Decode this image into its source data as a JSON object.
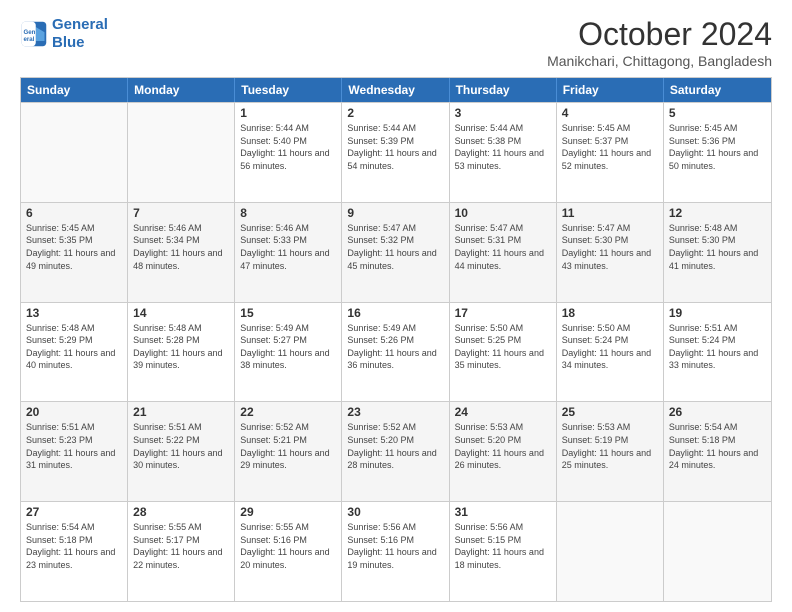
{
  "logo": {
    "line1": "General",
    "line2": "Blue"
  },
  "title": {
    "month_year": "October 2024",
    "location": "Manikchari, Chittagong, Bangladesh"
  },
  "weekdays": [
    "Sunday",
    "Monday",
    "Tuesday",
    "Wednesday",
    "Thursday",
    "Friday",
    "Saturday"
  ],
  "rows": [
    [
      {
        "day": "",
        "sunrise": "",
        "sunset": "",
        "daylight": ""
      },
      {
        "day": "",
        "sunrise": "",
        "sunset": "",
        "daylight": ""
      },
      {
        "day": "1",
        "sunrise": "Sunrise: 5:44 AM",
        "sunset": "Sunset: 5:40 PM",
        "daylight": "Daylight: 11 hours and 56 minutes."
      },
      {
        "day": "2",
        "sunrise": "Sunrise: 5:44 AM",
        "sunset": "Sunset: 5:39 PM",
        "daylight": "Daylight: 11 hours and 54 minutes."
      },
      {
        "day": "3",
        "sunrise": "Sunrise: 5:44 AM",
        "sunset": "Sunset: 5:38 PM",
        "daylight": "Daylight: 11 hours and 53 minutes."
      },
      {
        "day": "4",
        "sunrise": "Sunrise: 5:45 AM",
        "sunset": "Sunset: 5:37 PM",
        "daylight": "Daylight: 11 hours and 52 minutes."
      },
      {
        "day": "5",
        "sunrise": "Sunrise: 5:45 AM",
        "sunset": "Sunset: 5:36 PM",
        "daylight": "Daylight: 11 hours and 50 minutes."
      }
    ],
    [
      {
        "day": "6",
        "sunrise": "Sunrise: 5:45 AM",
        "sunset": "Sunset: 5:35 PM",
        "daylight": "Daylight: 11 hours and 49 minutes."
      },
      {
        "day": "7",
        "sunrise": "Sunrise: 5:46 AM",
        "sunset": "Sunset: 5:34 PM",
        "daylight": "Daylight: 11 hours and 48 minutes."
      },
      {
        "day": "8",
        "sunrise": "Sunrise: 5:46 AM",
        "sunset": "Sunset: 5:33 PM",
        "daylight": "Daylight: 11 hours and 47 minutes."
      },
      {
        "day": "9",
        "sunrise": "Sunrise: 5:47 AM",
        "sunset": "Sunset: 5:32 PM",
        "daylight": "Daylight: 11 hours and 45 minutes."
      },
      {
        "day": "10",
        "sunrise": "Sunrise: 5:47 AM",
        "sunset": "Sunset: 5:31 PM",
        "daylight": "Daylight: 11 hours and 44 minutes."
      },
      {
        "day": "11",
        "sunrise": "Sunrise: 5:47 AM",
        "sunset": "Sunset: 5:30 PM",
        "daylight": "Daylight: 11 hours and 43 minutes."
      },
      {
        "day": "12",
        "sunrise": "Sunrise: 5:48 AM",
        "sunset": "Sunset: 5:30 PM",
        "daylight": "Daylight: 11 hours and 41 minutes."
      }
    ],
    [
      {
        "day": "13",
        "sunrise": "Sunrise: 5:48 AM",
        "sunset": "Sunset: 5:29 PM",
        "daylight": "Daylight: 11 hours and 40 minutes."
      },
      {
        "day": "14",
        "sunrise": "Sunrise: 5:48 AM",
        "sunset": "Sunset: 5:28 PM",
        "daylight": "Daylight: 11 hours and 39 minutes."
      },
      {
        "day": "15",
        "sunrise": "Sunrise: 5:49 AM",
        "sunset": "Sunset: 5:27 PM",
        "daylight": "Daylight: 11 hours and 38 minutes."
      },
      {
        "day": "16",
        "sunrise": "Sunrise: 5:49 AM",
        "sunset": "Sunset: 5:26 PM",
        "daylight": "Daylight: 11 hours and 36 minutes."
      },
      {
        "day": "17",
        "sunrise": "Sunrise: 5:50 AM",
        "sunset": "Sunset: 5:25 PM",
        "daylight": "Daylight: 11 hours and 35 minutes."
      },
      {
        "day": "18",
        "sunrise": "Sunrise: 5:50 AM",
        "sunset": "Sunset: 5:24 PM",
        "daylight": "Daylight: 11 hours and 34 minutes."
      },
      {
        "day": "19",
        "sunrise": "Sunrise: 5:51 AM",
        "sunset": "Sunset: 5:24 PM",
        "daylight": "Daylight: 11 hours and 33 minutes."
      }
    ],
    [
      {
        "day": "20",
        "sunrise": "Sunrise: 5:51 AM",
        "sunset": "Sunset: 5:23 PM",
        "daylight": "Daylight: 11 hours and 31 minutes."
      },
      {
        "day": "21",
        "sunrise": "Sunrise: 5:51 AM",
        "sunset": "Sunset: 5:22 PM",
        "daylight": "Daylight: 11 hours and 30 minutes."
      },
      {
        "day": "22",
        "sunrise": "Sunrise: 5:52 AM",
        "sunset": "Sunset: 5:21 PM",
        "daylight": "Daylight: 11 hours and 29 minutes."
      },
      {
        "day": "23",
        "sunrise": "Sunrise: 5:52 AM",
        "sunset": "Sunset: 5:20 PM",
        "daylight": "Daylight: 11 hours and 28 minutes."
      },
      {
        "day": "24",
        "sunrise": "Sunrise: 5:53 AM",
        "sunset": "Sunset: 5:20 PM",
        "daylight": "Daylight: 11 hours and 26 minutes."
      },
      {
        "day": "25",
        "sunrise": "Sunrise: 5:53 AM",
        "sunset": "Sunset: 5:19 PM",
        "daylight": "Daylight: 11 hours and 25 minutes."
      },
      {
        "day": "26",
        "sunrise": "Sunrise: 5:54 AM",
        "sunset": "Sunset: 5:18 PM",
        "daylight": "Daylight: 11 hours and 24 minutes."
      }
    ],
    [
      {
        "day": "27",
        "sunrise": "Sunrise: 5:54 AM",
        "sunset": "Sunset: 5:18 PM",
        "daylight": "Daylight: 11 hours and 23 minutes."
      },
      {
        "day": "28",
        "sunrise": "Sunrise: 5:55 AM",
        "sunset": "Sunset: 5:17 PM",
        "daylight": "Daylight: 11 hours and 22 minutes."
      },
      {
        "day": "29",
        "sunrise": "Sunrise: 5:55 AM",
        "sunset": "Sunset: 5:16 PM",
        "daylight": "Daylight: 11 hours and 20 minutes."
      },
      {
        "day": "30",
        "sunrise": "Sunrise: 5:56 AM",
        "sunset": "Sunset: 5:16 PM",
        "daylight": "Daylight: 11 hours and 19 minutes."
      },
      {
        "day": "31",
        "sunrise": "Sunrise: 5:56 AM",
        "sunset": "Sunset: 5:15 PM",
        "daylight": "Daylight: 11 hours and 18 minutes."
      },
      {
        "day": "",
        "sunrise": "",
        "sunset": "",
        "daylight": ""
      },
      {
        "day": "",
        "sunrise": "",
        "sunset": "",
        "daylight": ""
      }
    ]
  ]
}
